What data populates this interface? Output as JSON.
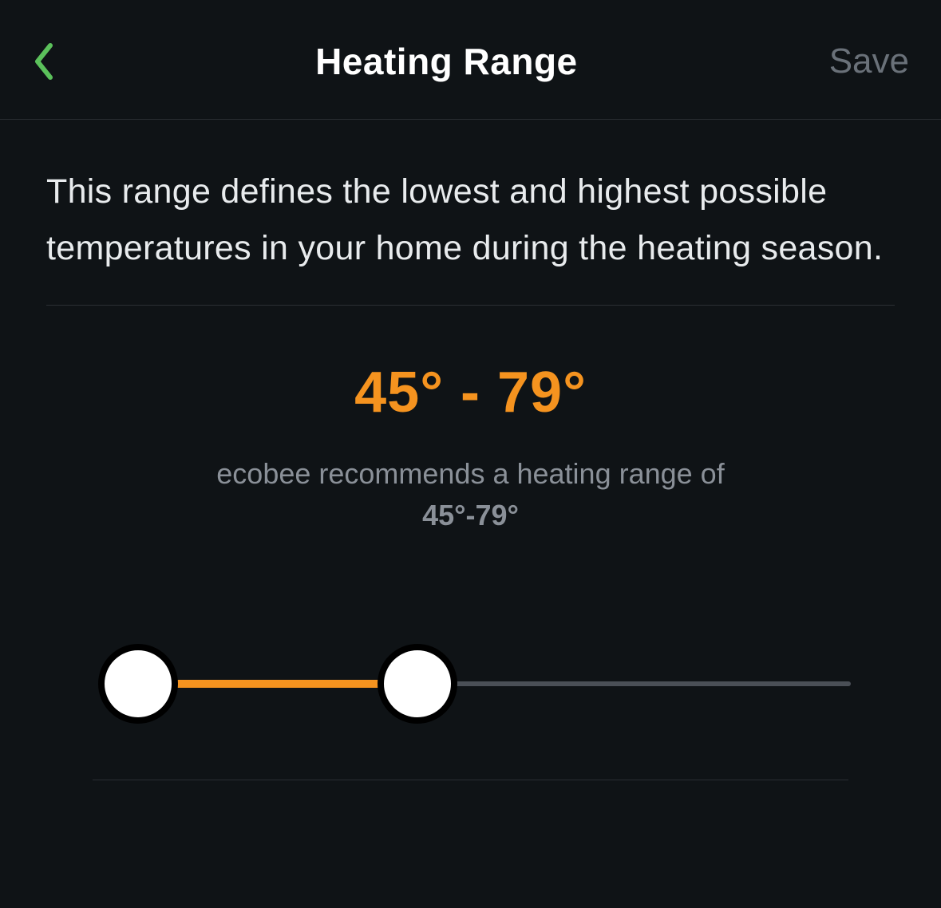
{
  "header": {
    "title": "Heating Range",
    "save_label": "Save"
  },
  "description": "This range defines the lowest and highest possible temperatures in your home during the heating season.",
  "range": {
    "display": "45° - 79°",
    "low": 45,
    "high": 79,
    "min": 45,
    "max": 120
  },
  "recommendation": {
    "prefix": "ecobee recommends a heating range of ",
    "value": "45°-79°"
  },
  "colors": {
    "accent": "#f5931f",
    "back_icon": "#5bc15b"
  },
  "slider": {
    "low_percent": 0,
    "high_percent": 40
  }
}
